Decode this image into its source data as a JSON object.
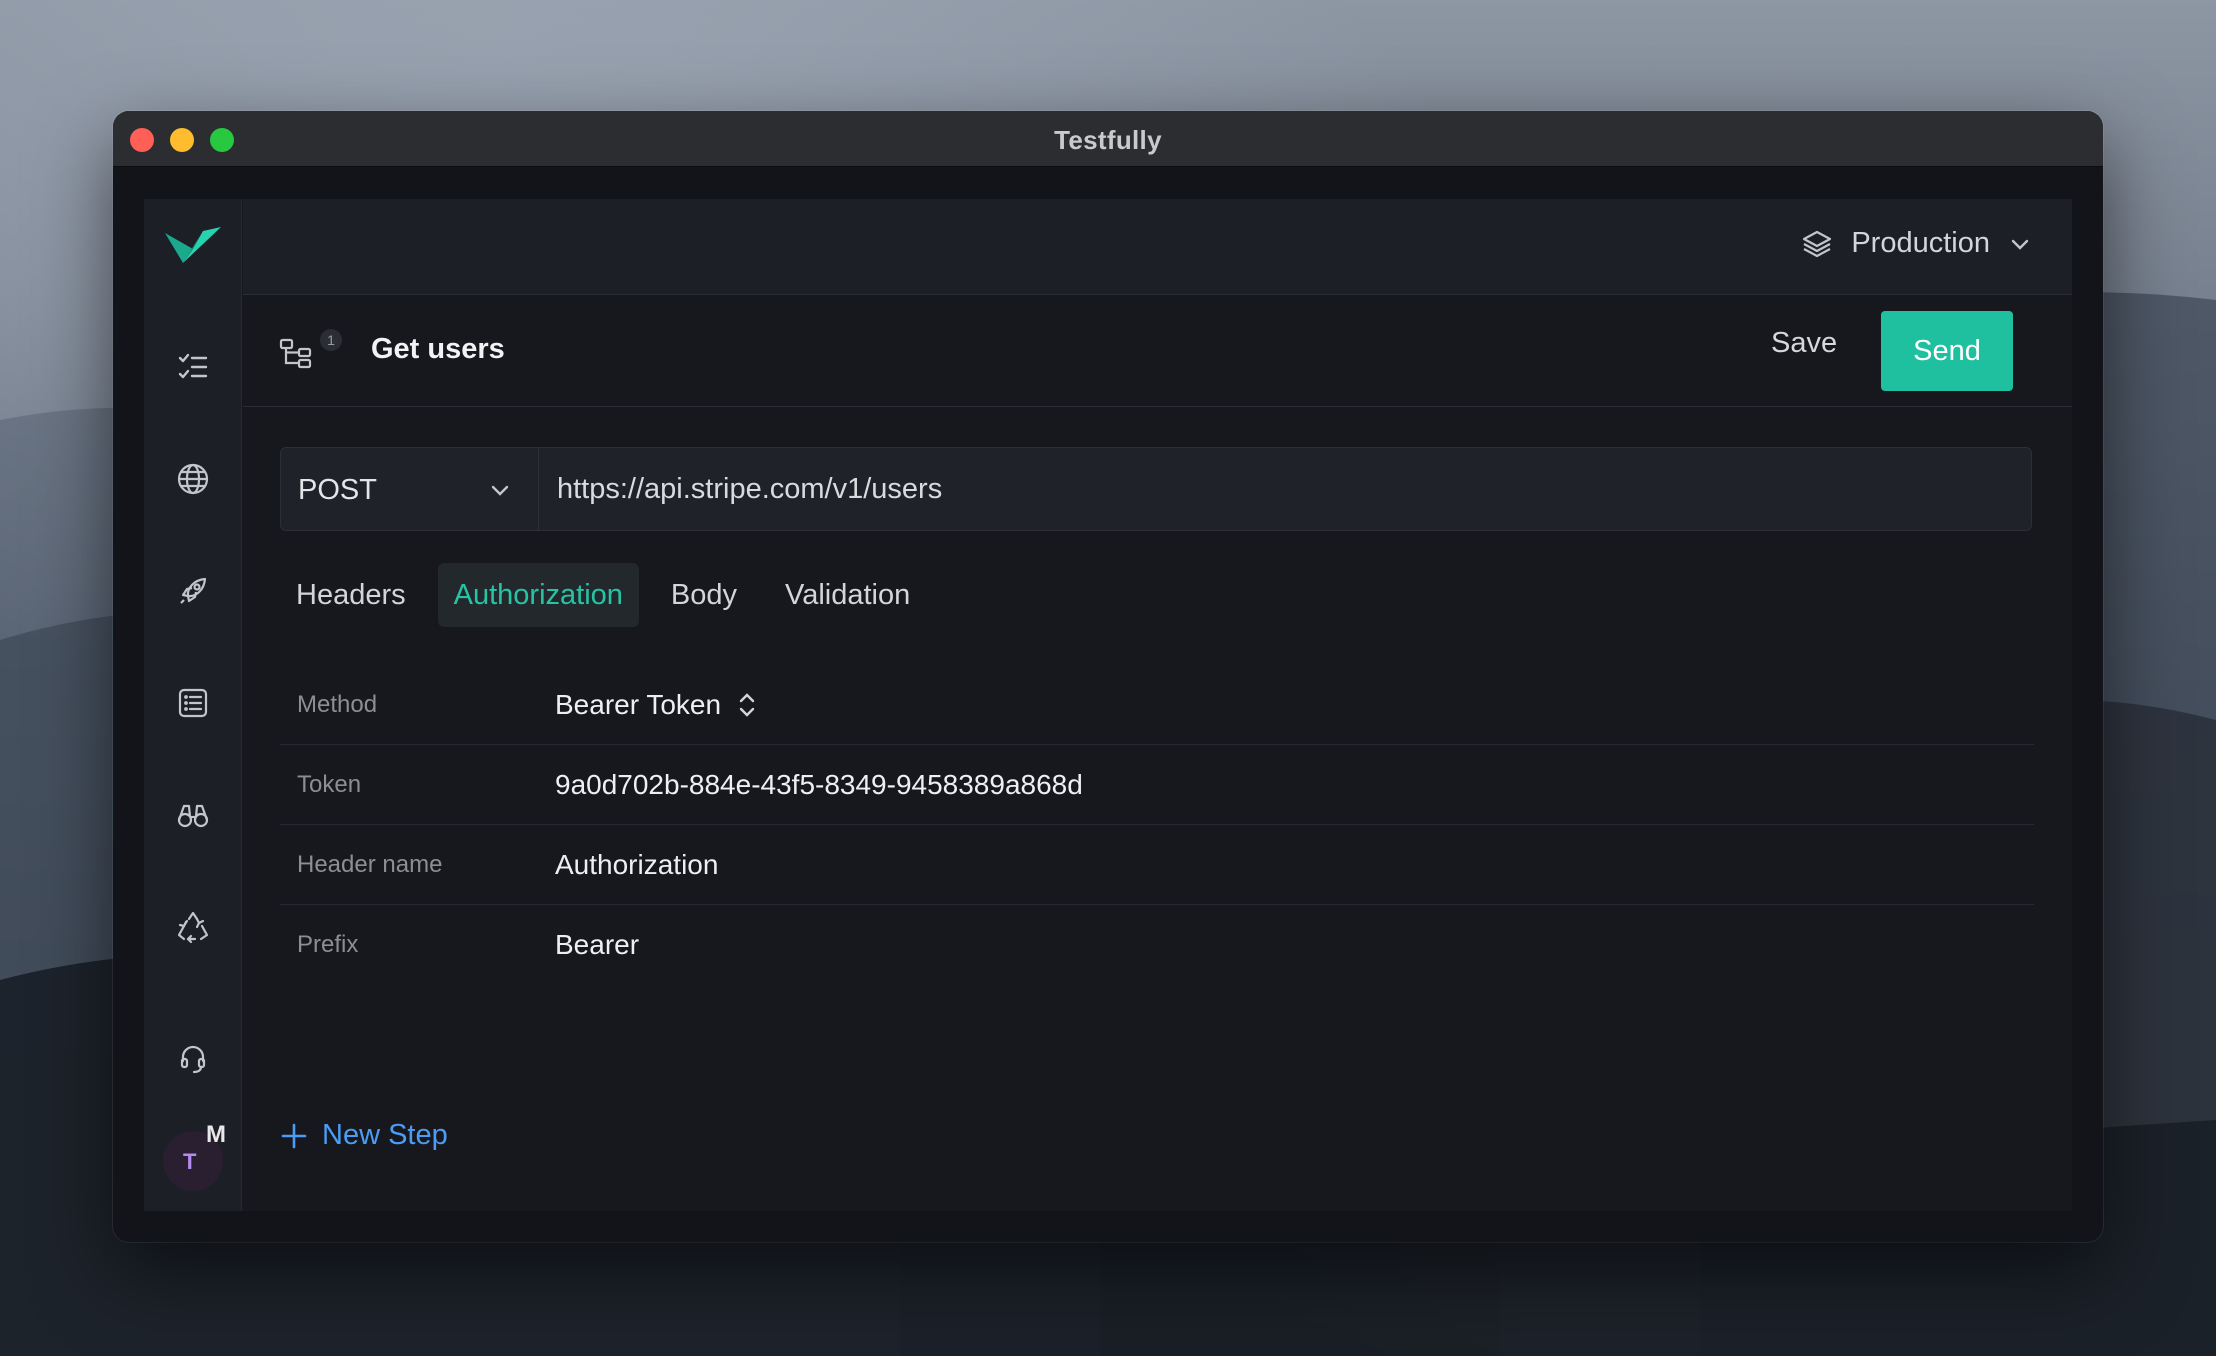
{
  "window": {
    "title": "Testfully"
  },
  "topbar": {
    "environment": "Production"
  },
  "request": {
    "step_count": "1",
    "title": "Get users",
    "save_label": "Save",
    "send_label": "Send",
    "method": "POST",
    "url": "https://api.stripe.com/v1/users"
  },
  "tabs": [
    {
      "label": "Headers"
    },
    {
      "label": "Authorization"
    },
    {
      "label": "Body"
    },
    {
      "label": "Validation"
    }
  ],
  "auth": {
    "fields": [
      {
        "label": "Method",
        "value": "Bearer Token"
      },
      {
        "label": "Token",
        "value": "9a0d702b-884e-43f5-8349-9458389a868d"
      },
      {
        "label": "Header name",
        "value": "Authorization"
      },
      {
        "label": "Prefix",
        "value": "Bearer"
      }
    ]
  },
  "new_step_label": "New Step",
  "user": {
    "initial": "T",
    "badge": "M"
  },
  "colors": {
    "accent": "#1ec0a0",
    "link": "#4b9cf5",
    "background": "#16181d"
  }
}
